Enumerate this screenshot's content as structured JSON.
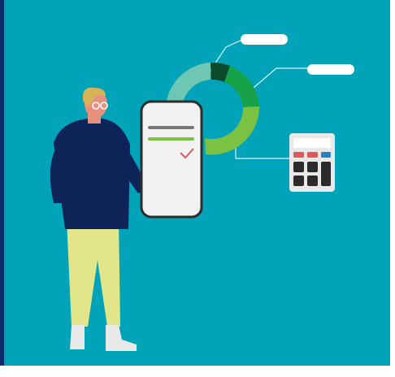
{
  "colors": {
    "panel": "#00A3B8",
    "accent_bar": "#0E2A6E",
    "donut_teal": "#6EC6B4",
    "donut_dark": "#0B4A2A",
    "donut_green": "#17A24A",
    "donut_lime": "#7CC242",
    "callout_label": "#FFFFFF",
    "callout_line": "#D9F3F6",
    "phone_body": "#F2F2F2",
    "phone_outline": "#2C2C2C",
    "phone_bar_grey": "#777777",
    "phone_bar_green": "#7CC242",
    "check": "#E05757",
    "calculator_body": "#E8E8E8",
    "calculator_key_dark": "#2B2B2B",
    "calculator_key_red": "#E05757",
    "calculator_key_blue": "#2A7FC1",
    "sweater": "#0E2458",
    "pants": "#E3E58A",
    "skin": "#E8907E",
    "hair": "#D7B256",
    "shoe": "#E9E9E9"
  },
  "icons": {
    "illustration": "person-with-phone-illustration",
    "chart": "donut-chart-icon",
    "calculator": "calculator-icon",
    "check": "checkmark-icon"
  }
}
